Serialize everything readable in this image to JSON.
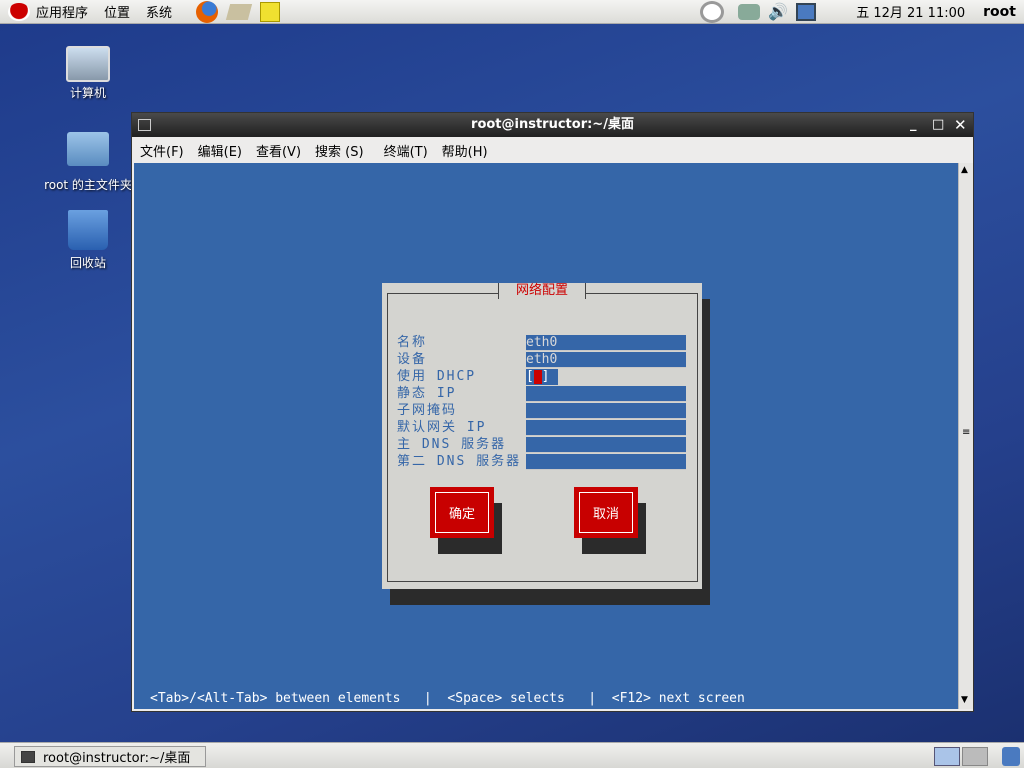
{
  "top_panel": {
    "menus": [
      "应用程序",
      "位置",
      "系统"
    ],
    "clock": "五 12月 21 11:00",
    "user": "root"
  },
  "desktop": {
    "icons": [
      "计算机",
      "root 的主文件夹",
      "回收站"
    ]
  },
  "window": {
    "title": "root@instructor:~/桌面",
    "menu": [
      "文件(F)",
      "编辑(E)",
      "查看(V)",
      "搜索 (S)",
      "终端(T)",
      "帮助(H)"
    ]
  },
  "dialog": {
    "title": "网络配置",
    "fields": [
      {
        "label": "名称",
        "value": "eth0"
      },
      {
        "label": "设备",
        "value": "eth0"
      },
      {
        "label": "使用 DHCP",
        "value": "[ ]",
        "type": "checkbox",
        "checked": false
      },
      {
        "label": "静态 IP",
        "value": ""
      },
      {
        "label": "子网掩码",
        "value": ""
      },
      {
        "label": "默认网关 IP",
        "value": ""
      },
      {
        "label": "主 DNS 服务器",
        "value": ""
      },
      {
        "label": "第二 DNS 服务器",
        "value": ""
      }
    ],
    "ok": "确定",
    "cancel": "取消"
  },
  "status_line": "<Tab>/<Alt-Tab> between elements   |  <Space> selects   |  <F12> next screen",
  "taskbar": {
    "task": "root@instructor:~/桌面"
  },
  "colors": {
    "terminal_bg": "#3566a8",
    "dialog_bg": "#d4d4d0",
    "button": "#c80000"
  }
}
